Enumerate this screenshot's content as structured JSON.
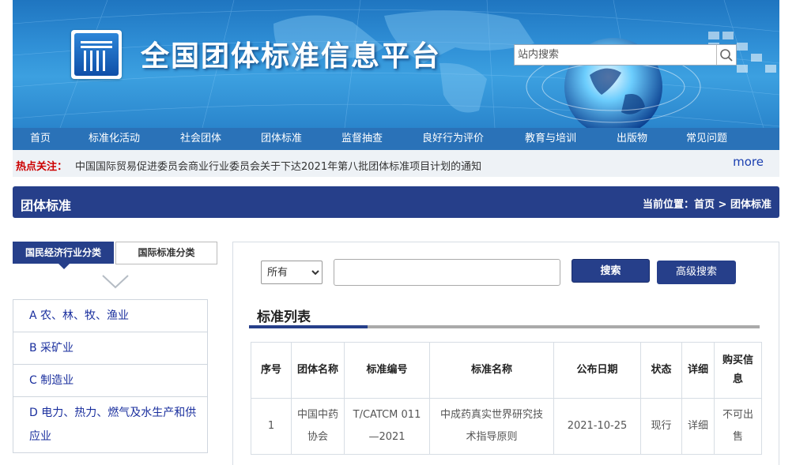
{
  "site": {
    "title": "全国团体标准信息平台",
    "search_placeholder": "站内搜索"
  },
  "nav": {
    "items": [
      "首页",
      "标准化活动",
      "社会团体",
      "团体标准",
      "监督抽查",
      "良好行为评价",
      "教育与培训",
      "出版物",
      "常见问题"
    ]
  },
  "hot": {
    "label": "热点关注：",
    "text": "中国国际贸易促进委员会商业行业委员会关于下达2021年第八批团体标准项目计划的通知",
    "more": "more"
  },
  "section": {
    "title": "团体标准",
    "crumb_prefix": "当前位置：",
    "crumb_home": "首页",
    "crumb_sep": " > ",
    "crumb_current": "团体标准"
  },
  "sidebar": {
    "tab_active": "国民经济行业分类",
    "tab_other": "国际标准分类",
    "categories": [
      "A 农、林、牧、渔业",
      "B 采矿业",
      "C 制造业",
      "D 电力、热力、燃气及水生产和供应业"
    ]
  },
  "search": {
    "scope": "所有",
    "search_button": "搜索",
    "advanced_button": "高级搜索"
  },
  "list": {
    "title": "标准列表",
    "headers": [
      "序号",
      "团体名称",
      "标准编号",
      "标准名称",
      "公布日期",
      "状态",
      "详细",
      "购买信息"
    ],
    "rows": [
      {
        "no": "1",
        "org": "中国中药协会",
        "code": "T/CATCM 011—2021",
        "name": "中成药真实世界研究技术指导原则",
        "date": "2021-10-25",
        "status": "现行",
        "detail": "详细",
        "buy": "不可出售"
      }
    ]
  },
  "colors": {
    "nav_bg": "#2a72b8",
    "primary_dark": "#263f8a",
    "hot_red": "#cc0000",
    "link_blue": "#1a2f9e"
  }
}
